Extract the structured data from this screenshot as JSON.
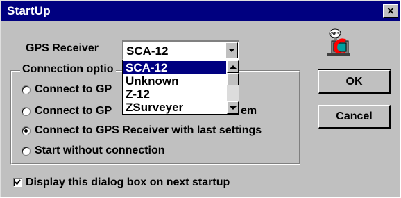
{
  "window": {
    "title": "StartUp",
    "close_glyph": "×"
  },
  "gps_receiver": {
    "label": "GPS Receiver",
    "selected": "SCA-12",
    "options": [
      "SCA-12",
      "Unknown",
      "Z-12",
      "ZSurveyer"
    ],
    "highlighted_index": 0,
    "icon": "gps-receiver-icon"
  },
  "connection": {
    "group_label": "Connection optio",
    "options": [
      {
        "label": "Connect to GP",
        "checked": false
      },
      {
        "label": "Connect to GP",
        "label_tail": "em",
        "checked": false
      },
      {
        "label": "Connect to GPS Receiver with last settings",
        "checked": true
      },
      {
        "label": "Start without connection",
        "checked": false
      }
    ]
  },
  "buttons": {
    "ok": "OK",
    "cancel": "Cancel"
  },
  "startup_checkbox": {
    "label": "Display this dialog box on next startup",
    "checked": true
  },
  "colors": {
    "title_bar": "#000080",
    "face": "#c0c0c0",
    "selection": "#000080"
  }
}
